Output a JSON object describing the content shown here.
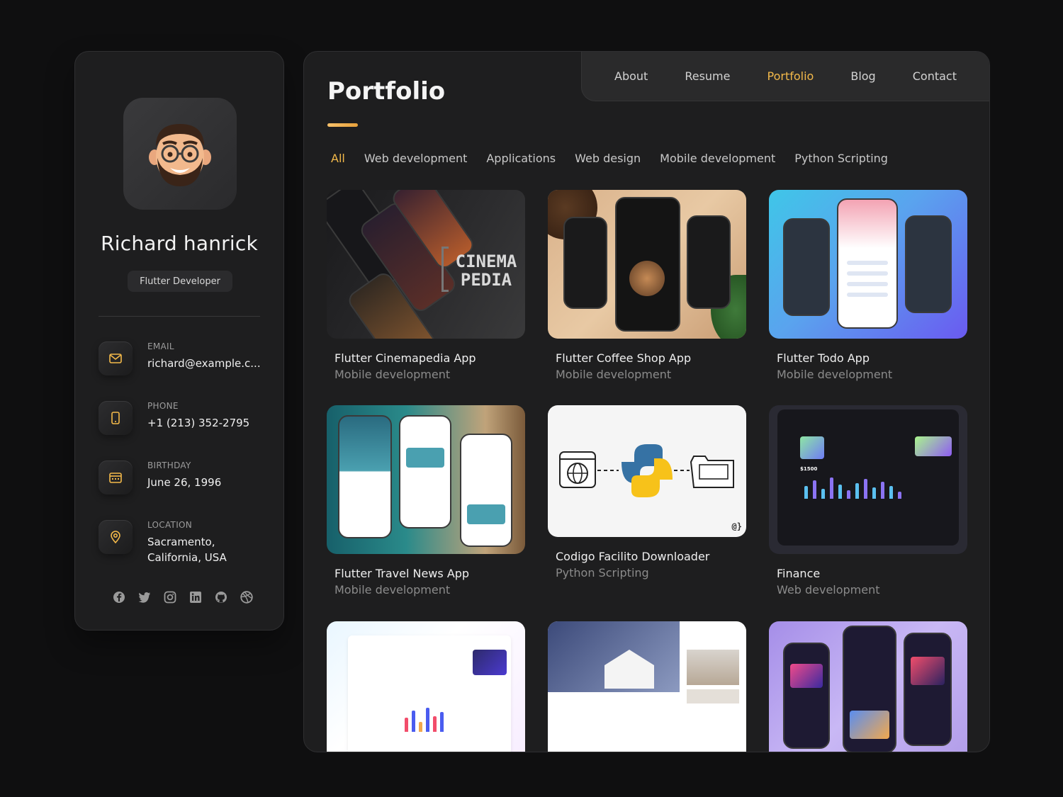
{
  "profile": {
    "name": "Richard hanrick",
    "role": "Flutter Developer"
  },
  "contacts": [
    {
      "label": "EMAIL",
      "value": "richard@example.c...",
      "icon": "mail-icon"
    },
    {
      "label": "PHONE",
      "value": "+1 (213) 352-2795",
      "icon": "phone-icon"
    },
    {
      "label": "BIRTHDAY",
      "value": "June 26, 1996",
      "icon": "calendar-icon"
    },
    {
      "label": "LOCATION",
      "value": "Sacramento, California, USA",
      "icon": "location-pin-icon"
    }
  ],
  "socials": [
    "facebook-icon",
    "twitter-icon",
    "instagram-icon",
    "linkedin-icon",
    "github-icon",
    "dribbble-icon"
  ],
  "nav": {
    "about": "About",
    "resume": "Resume",
    "portfolio": "Portfolio",
    "blog": "Blog",
    "contact": "Contact",
    "active": "Portfolio"
  },
  "page": {
    "title": "Portfolio"
  },
  "filters": {
    "all": "All",
    "web_development": "Web development",
    "applications": "Applications",
    "web_design": "Web design",
    "mobile_development": "Mobile development",
    "python_scripting": "Python Scripting",
    "active": "All"
  },
  "projects": [
    {
      "title": "Flutter Cinemapedia App",
      "category": "Mobile development",
      "thumb_text": "CINEMA PEDIA"
    },
    {
      "title": "Flutter Coffee Shop App",
      "category": "Mobile development"
    },
    {
      "title": "Flutter Todo App",
      "category": "Mobile development"
    },
    {
      "title": "Flutter Travel News App",
      "category": "Mobile development"
    },
    {
      "title": "Codigo Facilito Downloader",
      "category": "Python Scripting",
      "thumb_text": "@}"
    },
    {
      "title": "Finance",
      "category": "Web development",
      "thumb_text": "$1500"
    },
    {
      "title": "",
      "category": ""
    },
    {
      "title": "",
      "category": ""
    },
    {
      "title": "",
      "category": ""
    }
  ],
  "colors": {
    "accent": "#f3b94a",
    "card_bg": "#1e1e1f",
    "page_bg": "#0f0f10"
  }
}
